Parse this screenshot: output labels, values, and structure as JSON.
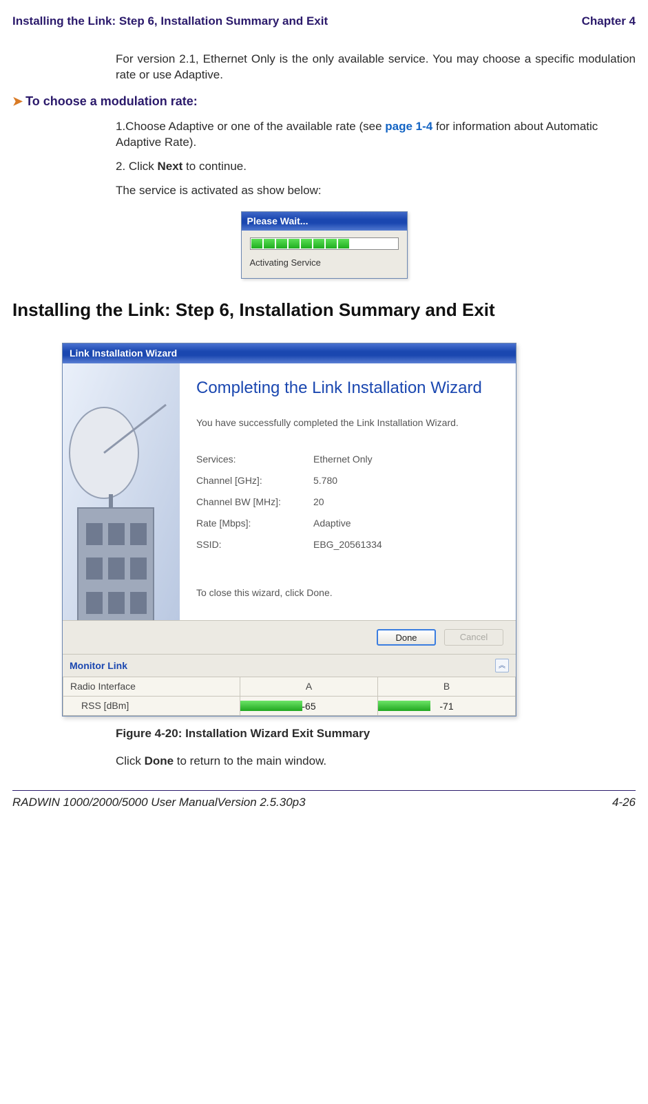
{
  "header": {
    "left": "Installing the Link: Step 6, Installation Summary and Exit",
    "right": "Chapter 4"
  },
  "intro": "For version 2.1, Ethernet Only is the only available service. You may choose a specific modulation rate or use Adaptive.",
  "procedure_title": "To choose a modulation rate:",
  "steps": {
    "s1_a": "1.Choose Adaptive or one of the available rate (see ",
    "s1_link": "page 1-4",
    "s1_b": " for information about Automatic Adaptive Rate).",
    "s2_a": "2. Click ",
    "s2_strong": "Next",
    "s2_b": " to continue.",
    "s2_after": "The service is activated as show below:"
  },
  "please_wait": {
    "title": "Please Wait...",
    "message": "Activating Service"
  },
  "heading": "Installing the Link: Step 6, Installation Summary and Exit",
  "wizard": {
    "titlebar": "Link Installation Wizard",
    "heading": "Completing the Link Installation Wizard",
    "message": "You have successfully completed the Link Installation  Wizard.",
    "rows": [
      {
        "label": "Services:",
        "value": "Ethernet Only"
      },
      {
        "label": "Channel [GHz]:",
        "value": "5.780"
      },
      {
        "label": "Channel BW [MHz]:",
        "value": "20"
      },
      {
        "label": "Rate [Mbps]:",
        "value": "Adaptive"
      },
      {
        "label": "SSID:",
        "value": "EBG_20561334"
      }
    ],
    "close_msg": "To close this wizard, click Done.",
    "done": "Done",
    "cancel": "Cancel",
    "monitor_title": "Monitor Link",
    "radio_interface": "Radio Interface",
    "col_a": "A",
    "col_b": "B",
    "rss_label": "RSS [dBm]",
    "rss_a": "-65",
    "rss_b": "-71"
  },
  "figure_caption": "Figure 4-20: Installation Wizard Exit Summary",
  "after_figure_a": "Click ",
  "after_figure_strong": "Done",
  "after_figure_b": " to return to the main window.",
  "footer": {
    "left": "RADWIN 1000/2000/5000 User ManualVersion  2.5.30p3",
    "right": "4-26"
  },
  "chart_data": {
    "type": "bar",
    "title": "RSS [dBm]",
    "categories": [
      "A",
      "B"
    ],
    "values": [
      -65,
      -71
    ],
    "xlabel": "Radio Interface",
    "ylabel": "RSS [dBm]",
    "ylim": [
      -100,
      0
    ]
  }
}
